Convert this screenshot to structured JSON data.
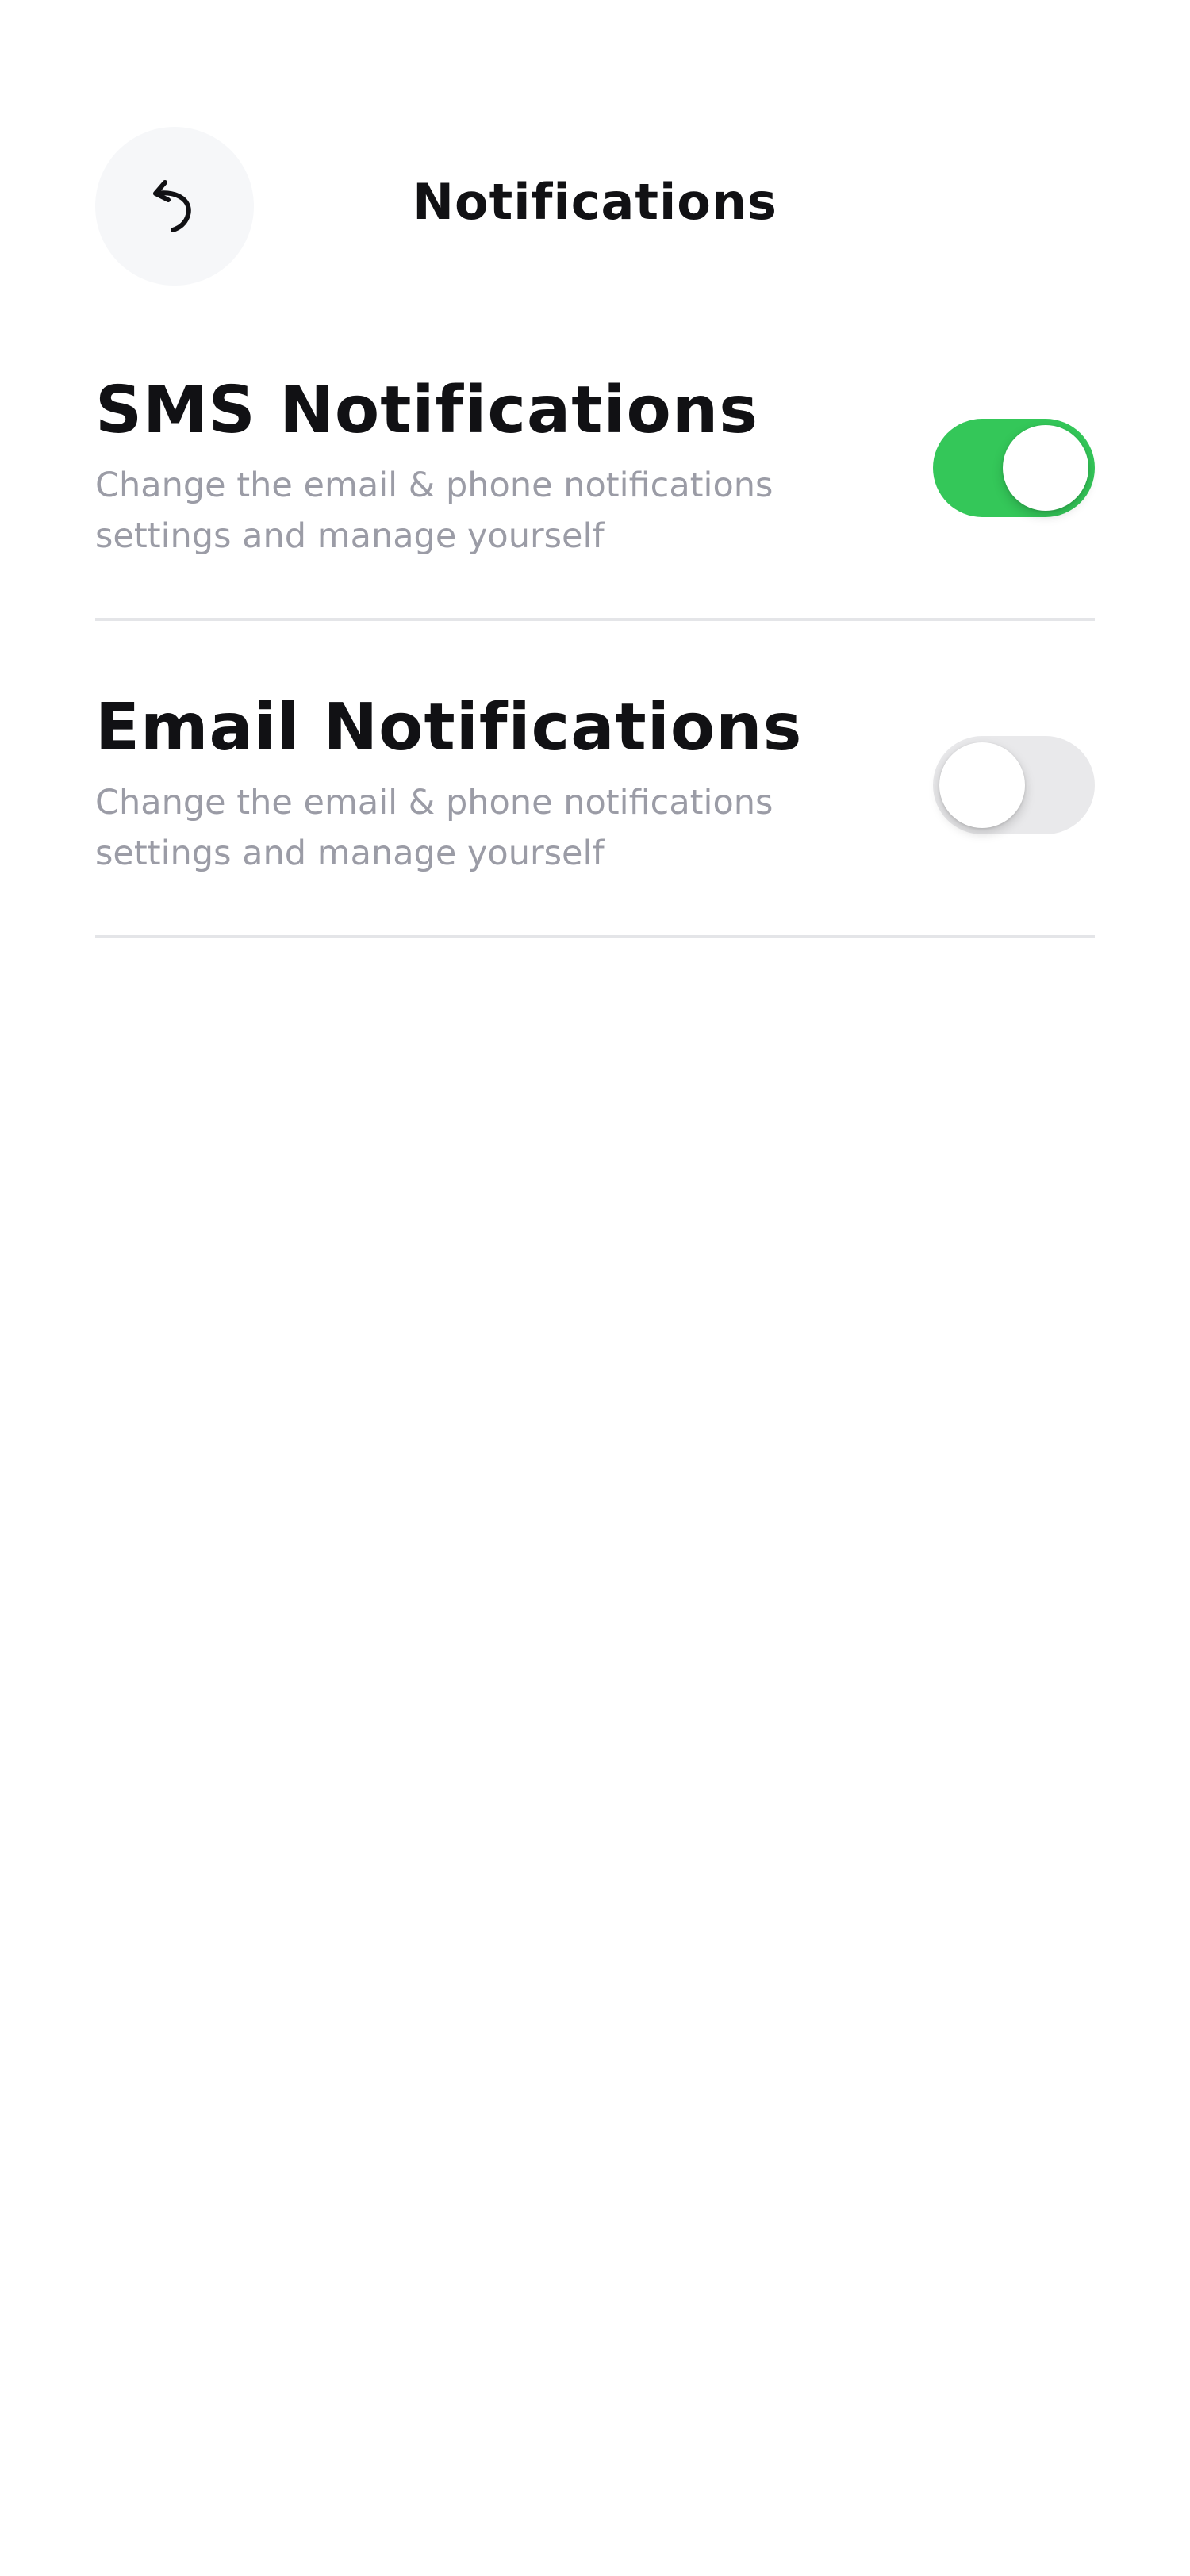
{
  "header": {
    "title": "Notifications",
    "back_icon": "back-arrow-icon"
  },
  "settings": [
    {
      "title": "SMS Notifications",
      "description": "Change the email & phone notifications settings and manage yourself",
      "enabled": true
    },
    {
      "title": "Email Notifications",
      "description": "Change the email & phone notifications settings and manage yourself",
      "enabled": false
    }
  ],
  "colors": {
    "toggle_on": "#34c759",
    "toggle_off": "#e9e9eb",
    "title_text": "#111114",
    "description_text": "#9b9ca6",
    "back_button_bg": "#f6f7f9",
    "divider": "#e4e5e8"
  }
}
